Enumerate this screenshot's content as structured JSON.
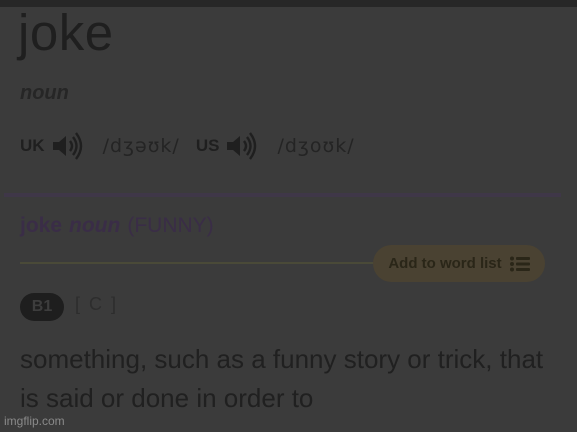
{
  "entry": {
    "headword": "joke",
    "part_of_speech": "noun",
    "pronunciations": [
      {
        "region": "UK",
        "ipa": "/dʒəʊk/"
      },
      {
        "region": "US",
        "ipa": "/dʒoʊk/"
      }
    ]
  },
  "sense": {
    "headword": "joke",
    "part_of_speech": "noun",
    "guideword": "(FUNNY)",
    "add_to_list_label": "Add to word list",
    "level": "B1",
    "grammar": "[ C ]",
    "definition": "something, such as a funny story or trick, that is said or done in order to"
  },
  "watermark": "imgflip.com",
  "icons": {
    "speaker": "speaker-icon",
    "list": "list-icon"
  },
  "colors": {
    "sense_title": "#3a2d47",
    "divider_purple": "#3f3748",
    "button_bg": "#4a4232",
    "level_badge_bg": "#1e1e1e"
  }
}
